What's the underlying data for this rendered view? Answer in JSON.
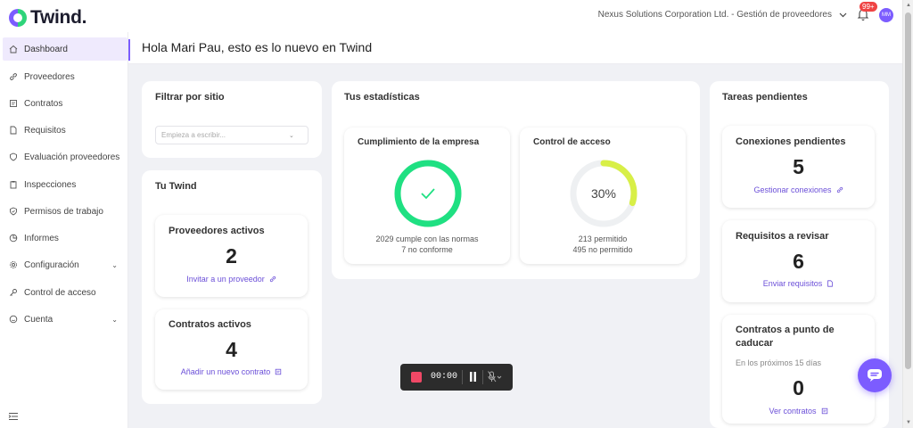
{
  "brand": {
    "name": "Twind."
  },
  "header": {
    "company": "Nexus Solutions Corporation Ltd. - Gestión de proveedores",
    "notifications_badge": "99+",
    "avatar_initials": "MM"
  },
  "sidebar": {
    "items": [
      {
        "label": "Dashboard",
        "icon": "home-icon",
        "active": true
      },
      {
        "label": "Proveedores",
        "icon": "link-icon"
      },
      {
        "label": "Contratos",
        "icon": "contract-icon"
      },
      {
        "label": "Requisitos",
        "icon": "document-icon"
      },
      {
        "label": "Evaluación proveedores",
        "icon": "shield-icon"
      },
      {
        "label": "Inspecciones",
        "icon": "clipboard-icon"
      },
      {
        "label": "Permisos de trabajo",
        "icon": "shield-check-icon"
      },
      {
        "label": "Informes",
        "icon": "pie-chart-icon"
      },
      {
        "label": "Configuración",
        "icon": "gear-icon"
      },
      {
        "label": "Control de acceso",
        "icon": "key-icon"
      },
      {
        "label": "Cuenta",
        "icon": "smile-icon"
      }
    ]
  },
  "main": {
    "greeting": "Hola Mari Pau, esto es lo nuevo en Twind",
    "filter": {
      "title": "Filtrar por sitio",
      "placeholder": "Empieza a escribir..."
    },
    "tu_twind": {
      "title": "Tu Twind",
      "proveedores": {
        "title": "Proveedores activos",
        "value": "2",
        "action": "Invitar a un proveedor"
      },
      "contratos": {
        "title": "Contratos activos",
        "value": "4",
        "action": "Añadir un nuevo contrato"
      }
    },
    "stats": {
      "title": "Tus estadísticas",
      "cumplimiento": {
        "title": "Cumplimiento de la empresa",
        "line1": "2029 cumple con las normas",
        "line2": "7 no conforme",
        "ring_fraction": 0.997,
        "color": "#1fe082"
      },
      "acceso": {
        "title": "Control de acceso",
        "percent_label": "30%",
        "percent": 0.3,
        "line1": "213 permitido",
        "line2": "495 no permitido",
        "color": "#d8ef47"
      }
    },
    "tareas": {
      "title": "Tareas pendientes",
      "conexiones": {
        "title": "Conexiones pendientes",
        "value": "5",
        "action": "Gestionar conexiones"
      },
      "requisitos": {
        "title": "Requisitos a revisar",
        "value": "6",
        "action": "Enviar requisitos"
      },
      "caducar": {
        "title_line1": "Contratos a punto de",
        "title_line2": "caducar",
        "subtitle": "En los próximos 15 días",
        "value": "0",
        "action": "Ver contratos"
      }
    }
  },
  "recorder": {
    "time": "00:00"
  }
}
